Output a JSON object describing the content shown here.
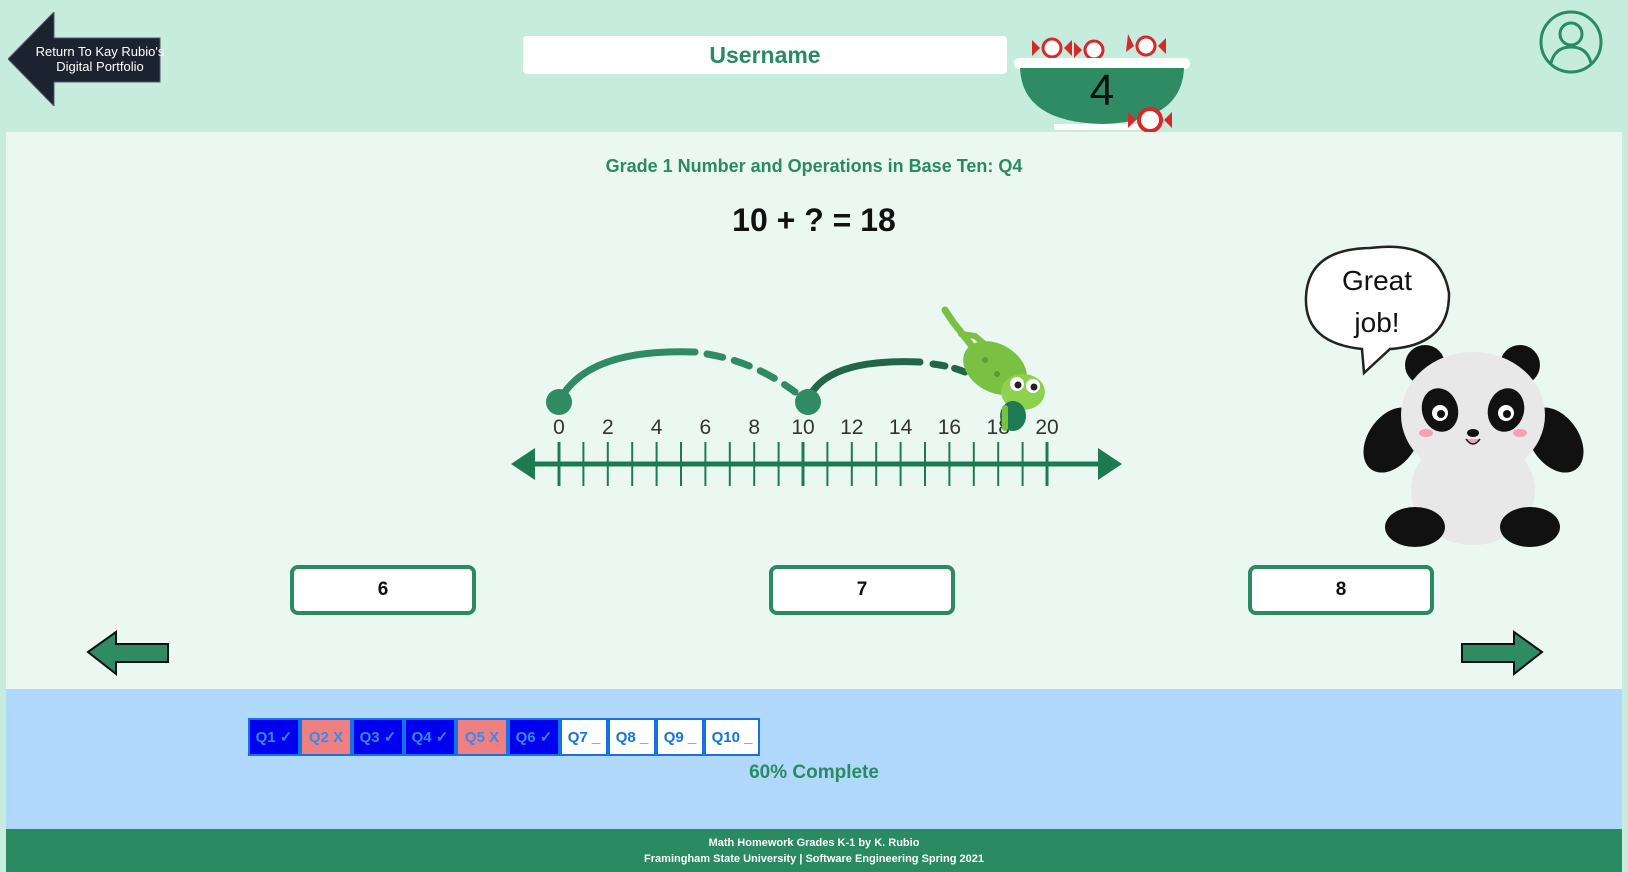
{
  "header": {
    "back_label": "Return To Kay Rubio's Digital Portfolio",
    "username": "Username",
    "candy_count": "4",
    "profile_icon": "user-circle-icon"
  },
  "question": {
    "title": "Grade 1 Number and Operations in Base Ten: Q4",
    "equation": "10 + ? = 18",
    "number_line_labels": [
      "0",
      "2",
      "4",
      "6",
      "8",
      "10",
      "12",
      "14",
      "16",
      "18",
      "20"
    ],
    "speech_bubble": "Great job!"
  },
  "answers": [
    "6",
    "7",
    "8"
  ],
  "nav": {
    "prev_icon": "arrow-left-icon",
    "next_icon": "arrow-right-icon"
  },
  "progress": {
    "questions": [
      {
        "label": "Q1 ✓",
        "status": "correct"
      },
      {
        "label": "Q2 X",
        "status": "wrong"
      },
      {
        "label": "Q3 ✓",
        "status": "correct"
      },
      {
        "label": "Q4 ✓",
        "status": "correct"
      },
      {
        "label": "Q5 X",
        "status": "wrong"
      },
      {
        "label": "Q6 ✓",
        "status": "correct"
      },
      {
        "label": "Q7 _",
        "status": "pending"
      },
      {
        "label": "Q8 _",
        "status": "pending"
      },
      {
        "label": "Q9 _",
        "status": "pending"
      },
      {
        "label": "Q10 _",
        "status": "pending"
      }
    ],
    "complete_text": "60% Complete",
    "percent_complete": 60
  },
  "footer": {
    "line1": "Math Homework Grades K-1 by K. Rubio",
    "line2": "Framingham State University | Software Engineering Spring 2021"
  },
  "colors": {
    "accent": "#2a8a62",
    "correct": "#0000ee",
    "wrong": "#f08080",
    "page_bg": "#c5ecdd",
    "progress_bg": "#b0d8fb"
  }
}
